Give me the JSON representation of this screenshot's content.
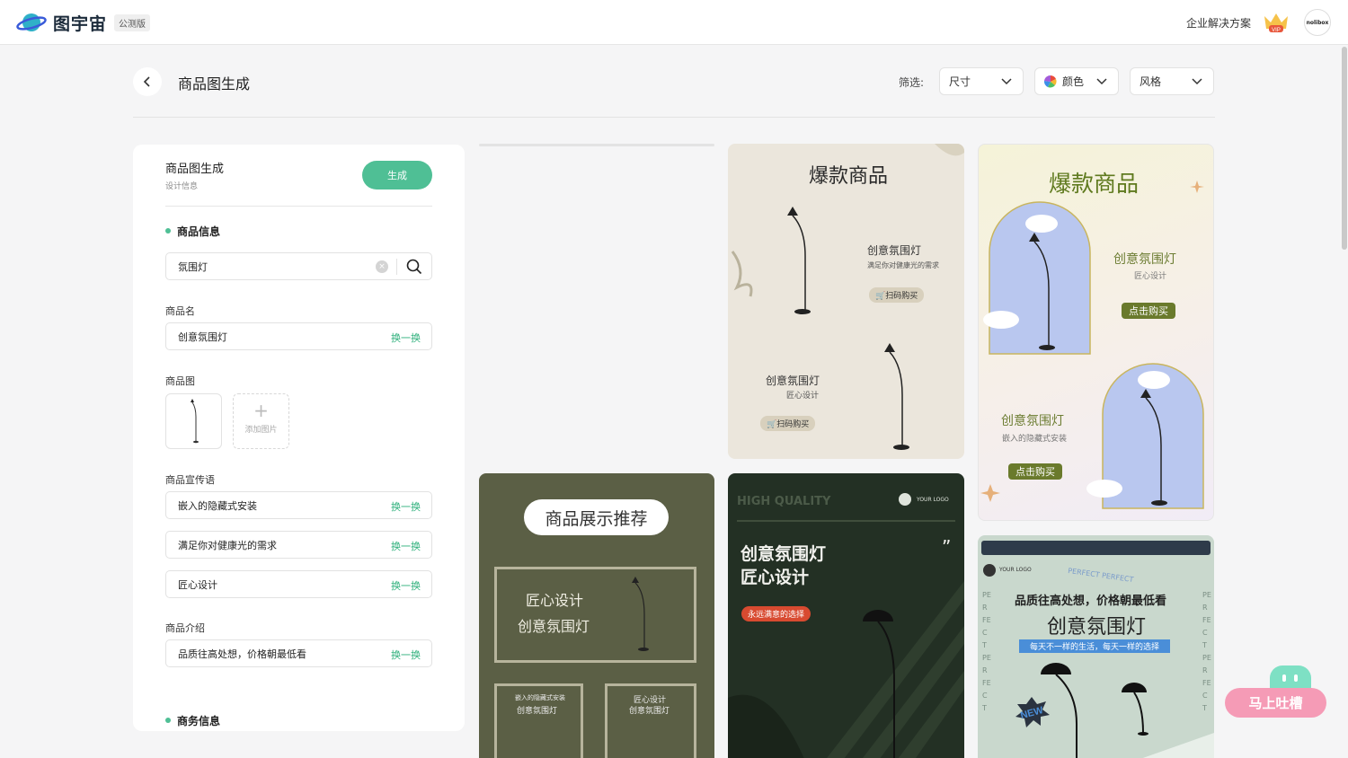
{
  "header": {
    "brand": "图宇宙",
    "badge": "公测版",
    "enterprise_link": "企业解决方案",
    "vip_label": "VIP",
    "avatar_text": "nolibox"
  },
  "page": {
    "title": "商品图生成",
    "filter_label": "筛选:",
    "filters": [
      {
        "label": "尺寸"
      },
      {
        "label": "颜色"
      },
      {
        "label": "风格"
      }
    ]
  },
  "panel": {
    "title": "商品图生成",
    "subtitle": "设计信息",
    "generate_button": "生成",
    "product_info_heading": "商品信息",
    "search_value": "氛围灯",
    "product_name_label": "商品名",
    "product_name_value": "创意氛围灯",
    "swap_label": "换一换",
    "product_image_label": "商品图",
    "add_image_label": "添加图片",
    "slogan_label": "商品宣传语",
    "slogans": [
      "嵌入的隐藏式安装",
      "满足你对健康光的需求",
      "匠心设计"
    ],
    "intro_label": "商品介绍",
    "intro_value": "品质往高处想，价格朝最低看",
    "business_heading": "商务信息"
  },
  "results": {
    "card2": {
      "headline": "爆款商品",
      "name": "创意氛围灯",
      "desc": "满足你对健康光的需求",
      "buy": "扫码购买",
      "name2": "创意氛围灯",
      "desc2": "匠心设计",
      "buy2": "扫码购买"
    },
    "card3": {
      "headline": "爆款商品",
      "name": "创意氛围灯",
      "desc": "匠心设计",
      "buy": "点击购买",
      "name2": "创意氛围灯",
      "desc2": "嵌入的隐藏式安装",
      "buy2": "点击购买"
    },
    "card4": {
      "headline": "商品展示推荐",
      "line1": "匠心设计",
      "line2": "创意氛围灯",
      "small1a": "嵌入的隐藏式安装",
      "small1b": "创意氛围灯",
      "small2a": "匠心设计",
      "small2b": "创意氛围灯"
    },
    "card5": {
      "top": "HIGH QUALITY",
      "logo": "YOUR LOGO",
      "title1": "创意氛围灯",
      "title2": "匠心设计",
      "tag": "永远满意的选择",
      "quote": "”"
    },
    "card6": {
      "logo": "YOUR LOGO",
      "perfect": "PERFECT PERFECT",
      "line1": "品质往高处想，价格朝最低看",
      "title": "创意氛围灯",
      "sub": "每天不一样的生活，每天一样的选择",
      "new": "NEW",
      "side": "PERFECT PERFECT"
    }
  },
  "feedback": {
    "label": "马上吐槽"
  },
  "colors": {
    "accent": "#4fbf95",
    "link": "#2fb07c"
  }
}
